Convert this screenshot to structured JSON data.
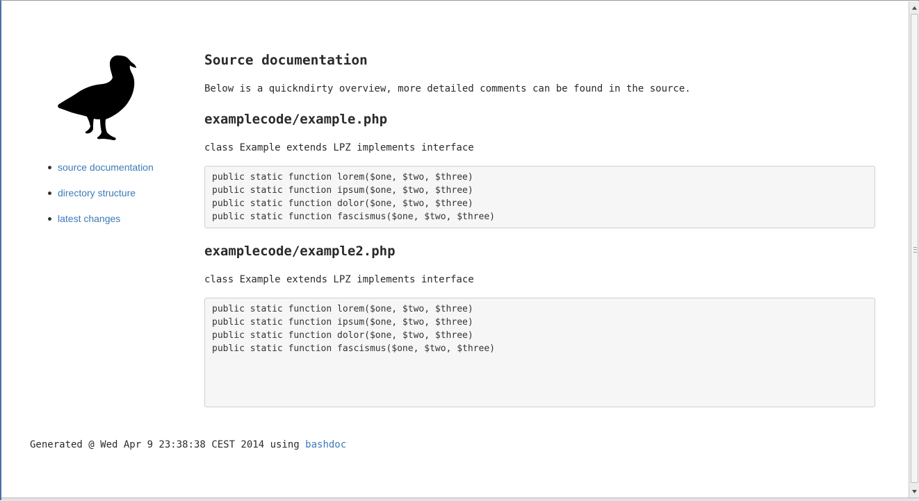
{
  "sidebar": {
    "logo_icon": "duck-silhouette-icon",
    "nav": [
      {
        "label": "source documentation"
      },
      {
        "label": "directory structure"
      },
      {
        "label": "latest changes"
      }
    ]
  },
  "main": {
    "title": "Source documentation",
    "intro": "Below is a quickndirty overview, more detailed comments can be found in the source.",
    "files": [
      {
        "path": "examplecode/example.php",
        "class_line": "class Example extends LPZ implements interface",
        "functions": [
          "public static function lorem($one, $two, $three)",
          "public static function ipsum($one, $two, $three)",
          "public static function dolor($one, $two, $three)",
          "public static function fascismus($one, $two, $three)"
        ]
      },
      {
        "path": "examplecode/example2.php",
        "class_line": "class Example extends LPZ implements interface",
        "functions": [
          "public static function lorem($one, $two, $three)",
          "public static function ipsum($one, $two, $three)",
          "public static function dolor($one, $two, $three)",
          "public static function fascismus($one, $two, $three)"
        ]
      }
    ]
  },
  "footer": {
    "text": "Generated @ Wed Apr 9 23:38:38 CEST 2014 using ",
    "link_label": "bashdoc"
  },
  "colors": {
    "link": "#3b7ab8",
    "code_background": "#f6f6f6",
    "text": "#2a2a2a"
  }
}
